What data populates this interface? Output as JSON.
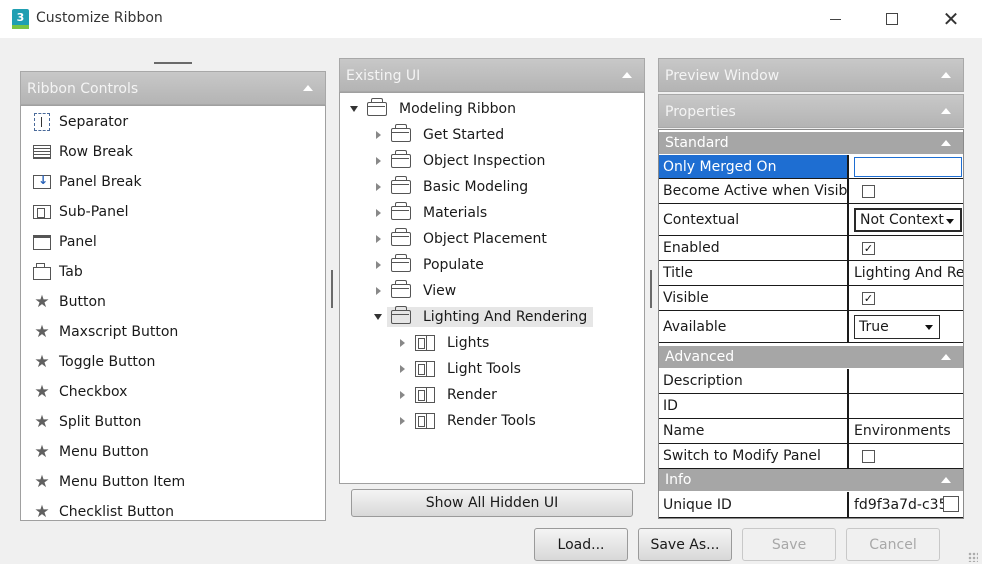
{
  "window": {
    "title": "Customize Ribbon",
    "app_icon_label": "3"
  },
  "ribbon_controls": {
    "header": "Ribbon Controls",
    "items": [
      {
        "label": "Separator",
        "icon": "separator-icon"
      },
      {
        "label": "Row Break",
        "icon": "row-break-icon"
      },
      {
        "label": "Panel Break",
        "icon": "panel-break-icon"
      },
      {
        "label": "Sub-Panel",
        "icon": "sub-panel-icon"
      },
      {
        "label": "Panel",
        "icon": "panel-icon"
      },
      {
        "label": "Tab",
        "icon": "tab-icon"
      },
      {
        "label": "Button",
        "icon": "star-icon"
      },
      {
        "label": "Maxscript Button",
        "icon": "star-icon"
      },
      {
        "label": "Toggle Button",
        "icon": "star-icon"
      },
      {
        "label": "Checkbox",
        "icon": "star-icon"
      },
      {
        "label": "Split Button",
        "icon": "star-icon"
      },
      {
        "label": "Menu Button",
        "icon": "star-icon"
      },
      {
        "label": "Menu Button Item",
        "icon": "star-icon"
      },
      {
        "label": "Checklist Button",
        "icon": "star-icon"
      }
    ]
  },
  "existing_ui": {
    "header": "Existing UI",
    "root": "Modeling Ribbon",
    "tabs": [
      "Get Started",
      "Object Inspection",
      "Basic Modeling",
      "Materials",
      "Object Placement",
      "Populate",
      "View",
      "Lighting And Rendering"
    ],
    "expanded_children": [
      "Lights",
      "Light Tools",
      "Render",
      "Render Tools"
    ],
    "show_hidden_button": "Show All Hidden UI"
  },
  "preview": {
    "header": "Preview Window"
  },
  "properties": {
    "header": "Properties",
    "standard": {
      "header": "Standard",
      "only_merged_on": "Only Merged On",
      "become_active": "Become Active when Visible",
      "become_active_checked": false,
      "contextual": "Contextual",
      "contextual_value": "Not Context",
      "enabled": "Enabled",
      "enabled_checked": true,
      "title": "Title",
      "title_value": "Lighting And Re",
      "visible": "Visible",
      "visible_checked": true,
      "available": "Available",
      "available_value": "True"
    },
    "advanced": {
      "header": "Advanced",
      "description": "Description",
      "id": "ID",
      "name": "Name",
      "name_value": "Environments",
      "switch_modify": "Switch to Modify Panel",
      "switch_modify_checked": false
    },
    "info": {
      "header": "Info",
      "unique_id": "Unique ID",
      "unique_id_value": "fd9f3a7d-c35"
    }
  },
  "footer": {
    "load": "Load...",
    "save_as": "Save As...",
    "save": "Save",
    "cancel": "Cancel"
  },
  "colors": {
    "selection": "#1e6ed2",
    "panel_header": "#b8b8b8",
    "section_header": "#a6a6a6"
  }
}
